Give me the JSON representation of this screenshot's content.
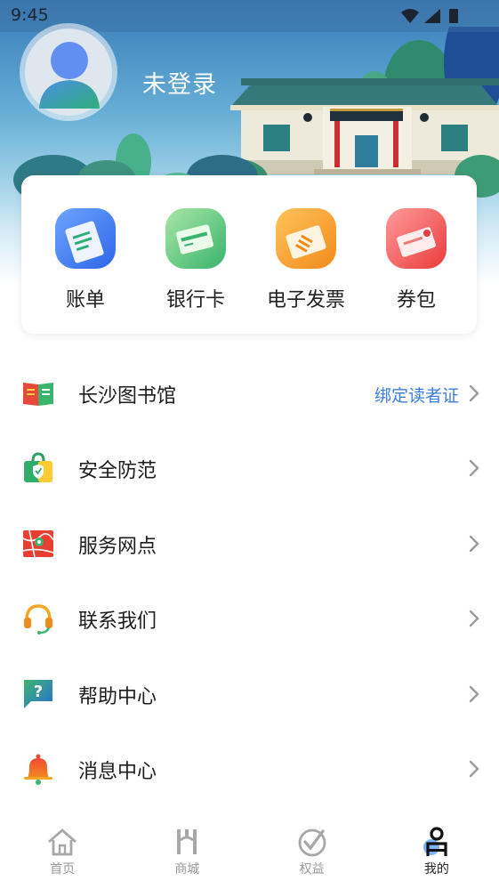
{
  "status_bar": {
    "time": "9:45"
  },
  "profile": {
    "username": "未登录"
  },
  "quick_actions": [
    {
      "label": "账单",
      "icon": "bill-icon"
    },
    {
      "label": "银行卡",
      "icon": "bank-card-icon"
    },
    {
      "label": "电子发票",
      "icon": "e-invoice-icon"
    },
    {
      "label": "券包",
      "icon": "coupon-icon"
    }
  ],
  "menu": [
    {
      "label": "长沙图书馆",
      "extra": "绑定读者证",
      "icon": "library-book-icon"
    },
    {
      "label": "安全防范",
      "extra": "",
      "icon": "security-bag-icon"
    },
    {
      "label": "服务网点",
      "extra": "",
      "icon": "map-pin-icon"
    },
    {
      "label": "联系我们",
      "extra": "",
      "icon": "headset-icon"
    },
    {
      "label": "帮助中心",
      "extra": "",
      "icon": "help-question-icon"
    },
    {
      "label": "消息中心",
      "extra": "",
      "icon": "bell-icon"
    }
  ],
  "bottom_nav": [
    {
      "label": "首页",
      "icon": "home-icon",
      "active": false
    },
    {
      "label": "商城",
      "icon": "mall-icon",
      "active": false
    },
    {
      "label": "权益",
      "icon": "benefits-check-icon",
      "active": false
    },
    {
      "label": "我的",
      "icon": "profile-icon",
      "active": true
    }
  ],
  "colors": {
    "link_blue": "#3d7fe0",
    "header_top": "#3a7bb8",
    "inactive_nav": "#999999"
  }
}
